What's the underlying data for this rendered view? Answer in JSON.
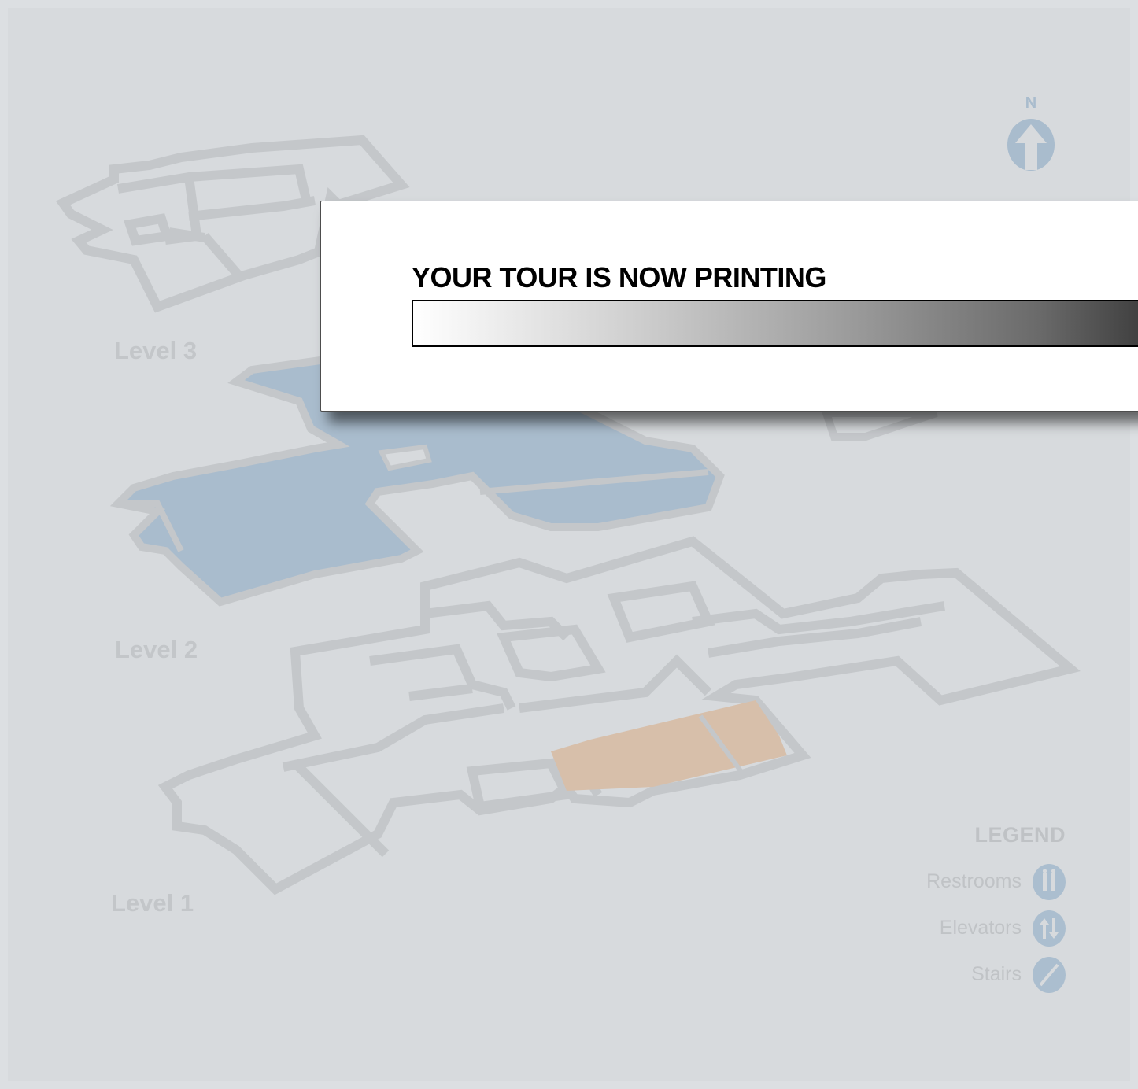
{
  "map": {
    "levels": [
      {
        "label": "Level 3"
      },
      {
        "label": "Level 2"
      },
      {
        "label": "Level 1"
      }
    ],
    "compass_letter": "N",
    "legend": {
      "title": "LEGEND",
      "items": [
        {
          "label": "Restrooms",
          "icon": "restroom-icon"
        },
        {
          "label": "Elevators",
          "icon": "elevator-icon"
        },
        {
          "label": "Stairs",
          "icon": "stairs-icon"
        }
      ]
    },
    "colors": {
      "background": "#d7dadd",
      "outline": "#c4c7ca",
      "level2_fill": "#a9bccd",
      "level1_highlight": "#d7bfaa",
      "icon_blue": "#abbecf"
    }
  },
  "print_dialog": {
    "title": "YOUR TOUR IS NOW PRINTING",
    "progress": 1.0
  }
}
